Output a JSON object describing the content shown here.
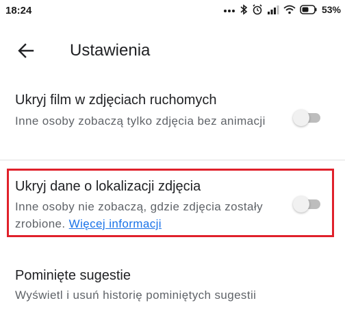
{
  "status_bar": {
    "time": "18:24",
    "battery_percent": "53%",
    "icons": [
      "more-dots-icon",
      "bluetooth-icon",
      "alarm-icon",
      "signal-icon",
      "wifi-icon",
      "battery-icon"
    ]
  },
  "app_bar": {
    "back_icon": "arrow-back-icon",
    "title": "Ustawienia"
  },
  "settings": [
    {
      "title": "Ukryj film w zdjęciach ruchomych",
      "description": "Inne osoby zobaczą tylko zdjęcia bez animacji",
      "toggle_on": false
    },
    {
      "title": "Ukryj dane o lokalizacji zdjęcia",
      "description": "Inne osoby nie zobaczą, gdzie zdjęcia zostały zrobione.",
      "link": "Więcej informacji",
      "toggle_on": false,
      "highlighted": true,
      "highlight_color": "#e0202a"
    },
    {
      "title": "Pominięte sugestie",
      "description": "Wyświetl i usuń historię pominiętych sugestii"
    }
  ],
  "colors": {
    "link": "#1a73e8",
    "toggle_track_off": "#bdbdbd",
    "secondary_text": "#5f6368"
  }
}
